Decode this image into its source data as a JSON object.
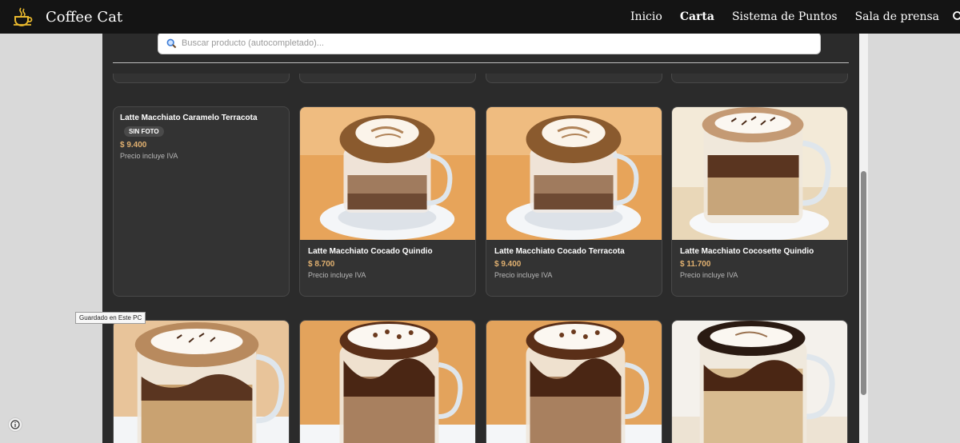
{
  "navbar": {
    "brand": "Coffee Cat",
    "brand_icon": "coffee-cup-icon",
    "links": [
      "Inicio",
      "Carta",
      "Sistema de Puntos",
      "Sala de prensa"
    ],
    "active_link": "Carta",
    "search_icon": "search-icon"
  },
  "search": {
    "placeholder": "Buscar producto (autocompletado)...",
    "value": ""
  },
  "products": [
    {
      "title": "Latte Macchiato Caramelo Terracota",
      "badge": "SIN FOTO",
      "price": "$ 9.400",
      "note": "Precio incluye IVA"
    },
    {
      "title": "Latte Macchiato Cocado Quindio",
      "price": "$ 8.700",
      "note": "Precio incluye IVA"
    },
    {
      "title": "Latte Macchiato Cocado Terracota",
      "price": "$ 9.400",
      "note": "Precio incluye IVA"
    },
    {
      "title": "Latte Macchiato Cocosette Quindio",
      "price": "$ 11.700",
      "note": "Precio incluye IVA"
    }
  ],
  "tooltip": "Guardado en Este PC",
  "colors": {
    "navbar": "#141414",
    "panel": "#2b2b2b",
    "card": "#333333",
    "price": "#e0b070",
    "brand_icon": "#e8b82e"
  }
}
